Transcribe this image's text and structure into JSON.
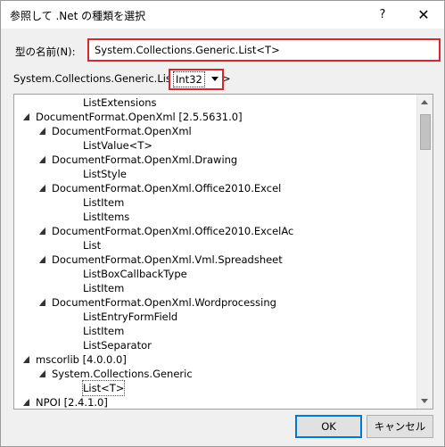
{
  "window": {
    "title": "参照して .Net の種類を選択",
    "help_label": "?",
    "close_label": "✕"
  },
  "type_name": {
    "label": "型の名前(N):",
    "value": "System.Collections.Generic.List<T>"
  },
  "generic_args": {
    "prefix": "System.Collections.Generic.List <",
    "selected": "Int32",
    "suffix": ">"
  },
  "tree": {
    "rows": [
      {
        "label": "ListExtensions",
        "level": 3,
        "expanded": null,
        "selected": false
      },
      {
        "label": "DocumentFormat.OpenXml [2.5.5631.0]",
        "level": 1,
        "expanded": true,
        "selected": false
      },
      {
        "label": "DocumentFormat.OpenXml",
        "level": 2,
        "expanded": true,
        "selected": false
      },
      {
        "label": "ListValue<T>",
        "level": 3,
        "expanded": null,
        "selected": false
      },
      {
        "label": "DocumentFormat.OpenXml.Drawing",
        "level": 2,
        "expanded": true,
        "selected": false
      },
      {
        "label": "ListStyle",
        "level": 3,
        "expanded": null,
        "selected": false
      },
      {
        "label": "DocumentFormat.OpenXml.Office2010.Excel",
        "level": 2,
        "expanded": true,
        "selected": false
      },
      {
        "label": "ListItem",
        "level": 3,
        "expanded": null,
        "selected": false
      },
      {
        "label": "ListItems",
        "level": 3,
        "expanded": null,
        "selected": false
      },
      {
        "label": "DocumentFormat.OpenXml.Office2010.ExcelAc",
        "level": 2,
        "expanded": true,
        "selected": false
      },
      {
        "label": "List",
        "level": 3,
        "expanded": null,
        "selected": false
      },
      {
        "label": "DocumentFormat.OpenXml.Vml.Spreadsheet",
        "level": 2,
        "expanded": true,
        "selected": false
      },
      {
        "label": "ListBoxCallbackType",
        "level": 3,
        "expanded": null,
        "selected": false
      },
      {
        "label": "ListItem",
        "level": 3,
        "expanded": null,
        "selected": false
      },
      {
        "label": "DocumentFormat.OpenXml.Wordprocessing",
        "level": 2,
        "expanded": true,
        "selected": false
      },
      {
        "label": "ListEntryFormField",
        "level": 3,
        "expanded": null,
        "selected": false
      },
      {
        "label": "ListItem",
        "level": 3,
        "expanded": null,
        "selected": false
      },
      {
        "label": "ListSeparator",
        "level": 3,
        "expanded": null,
        "selected": false
      },
      {
        "label": "mscorlib [4.0.0.0]",
        "level": 1,
        "expanded": true,
        "selected": false
      },
      {
        "label": "System.Collections.Generic",
        "level": 2,
        "expanded": true,
        "selected": false
      },
      {
        "label": "List<T>",
        "level": 3,
        "expanded": null,
        "selected": true
      },
      {
        "label": "NPOI [2.4.1.0]",
        "level": 1,
        "expanded": true,
        "selected": false
      }
    ]
  },
  "buttons": {
    "ok": "OK",
    "cancel": "キャンセル"
  },
  "colors": {
    "highlight_border": "#d9252b",
    "default_button_border": "#0078d7"
  }
}
